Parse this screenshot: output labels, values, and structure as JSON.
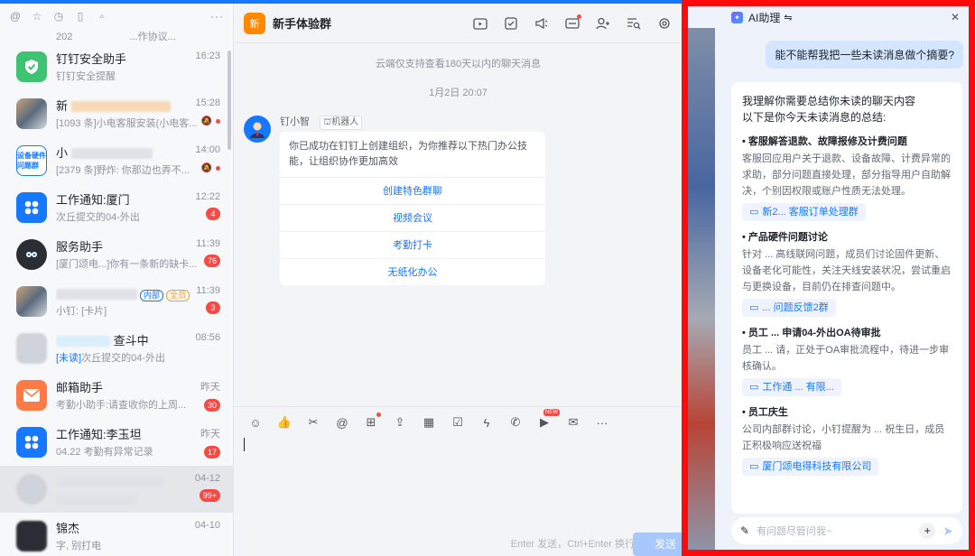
{
  "sidebar": {
    "top_icons": [
      "at-icon",
      "star-icon",
      "clock-icon",
      "doc-icon",
      "file-icon"
    ],
    "partial_row": {
      "left": "202",
      "right": "...作协议..."
    },
    "chats": [
      {
        "title": "钉钉安全助手",
        "sub": "钉钉安全提醒",
        "time": "16:23",
        "badge": "",
        "avatar": "shield-icon",
        "dot": false
      },
      {
        "title": "新",
        "sub": "[1093 条]小电客服安装(小电客...",
        "time": "15:28",
        "badge": "",
        "avatar": "group-photo",
        "dot": true
      },
      {
        "title": "小",
        "sub": "[2379 条]野炸: 你那边也弄不...",
        "time": "14:00",
        "badge": "",
        "avatar": "设备硬件问题群",
        "dot": true
      },
      {
        "title": "工作通知:厦门",
        "sub": "次丘提交的04-外出",
        "time": "12:22",
        "badge": "4",
        "avatar": "apps-icon",
        "dot": false
      },
      {
        "title": "服务助手",
        "sub": "[厦门颂电...]你有一条新的缺卡...",
        "time": "11:39",
        "badge": "76",
        "avatar": "bot-icon",
        "dot": false
      },
      {
        "title": "",
        "sub": "小钉: [卡片]",
        "time": "11:39",
        "badge": "3",
        "avatar": "group-photo",
        "dot": false,
        "tags": [
          "内部",
          "全员"
        ]
      },
      {
        "title": "",
        "sub": "次丘提交的04-外出",
        "sub_prefix": "[未读]",
        "time": "08:56",
        "badge": "",
        "avatar": "blur",
        "dot": false,
        "title_suffix": "查斗中"
      },
      {
        "title": "邮箱助手",
        "sub": "考勤小助手:请查收你的上周...",
        "time": "昨天",
        "badge": "30",
        "avatar": "mail-icon",
        "dot": false
      },
      {
        "title": "工作通知:李玉坦",
        "sub": "04.22 考勤有异常记录",
        "time": "昨天",
        "badge": "17",
        "avatar": "apps-icon",
        "dot": false
      },
      {
        "title": "",
        "sub": "",
        "time": "04-12",
        "badge": "99+",
        "avatar": "blur",
        "dot": false,
        "selected": true
      },
      {
        "title": "锦杰",
        "sub": "字, 别打电",
        "time": "04-10",
        "badge": "",
        "avatar": "blur",
        "dot": false
      }
    ]
  },
  "chat": {
    "group_initial": "新",
    "group_name": "新手体验群",
    "system_note": "云端仅支持查看180天以内的聊天消息",
    "date_note": "1月2日 20:07",
    "message": {
      "sender": "钉小智",
      "sender_tag": "机器人",
      "text": "你已成功在钉钉上创建组织，为你推荐以下热门办公技能，让组织协作更加高效",
      "actions": [
        "创建特色群聊",
        "视频会议",
        "考勤打卡",
        "无纸化办公"
      ]
    },
    "input": {
      "send_hint": "Enter 发送，Ctrl+Enter 换行",
      "send_label": "发送",
      "new_badge": "NEW"
    }
  },
  "ai": {
    "title": "AI助理",
    "title_suffix": "⇋",
    "user_question": "能不能帮我把一些未读消息做个摘要?",
    "intro_1": "我理解你需要总结你未读的聊天内容",
    "intro_2": "以下是你今天未读消息的总结:",
    "sections": [
      {
        "title": "• 客服解答退款、故障报修及计费问题",
        "body": "客服回应用户关于退款、设备故障、计费异常的求助，部分问题直接处理，部分指导用户自助解决，个别因权限或账户性质无法处理。",
        "link": "新2... 客服订单处理群"
      },
      {
        "title": "• 产品硬件问题讨论",
        "body": "针对 ... 高线联网问题，成员们讨论固件更新、设备老化可能性，关注天线安装状况，尝试重启与更换设备，目前仍在排查问题中。",
        "link": "... 问题反馈2群"
      },
      {
        "title": "• 员工 ... 申请04-外出OA待审批",
        "body": "员工 ... 请，正处于OA审批流程中，待进一步审核确认。",
        "link": "工作通 ... 有限..."
      },
      {
        "title": "• 员工庆生",
        "body": "公司内部群讨论，小钉提醒为 ... 祝生日，成员正积极响应送祝福",
        "link": "厦门颂电得科技有限公司"
      }
    ],
    "input_placeholder": "有问题尽管问我~"
  }
}
